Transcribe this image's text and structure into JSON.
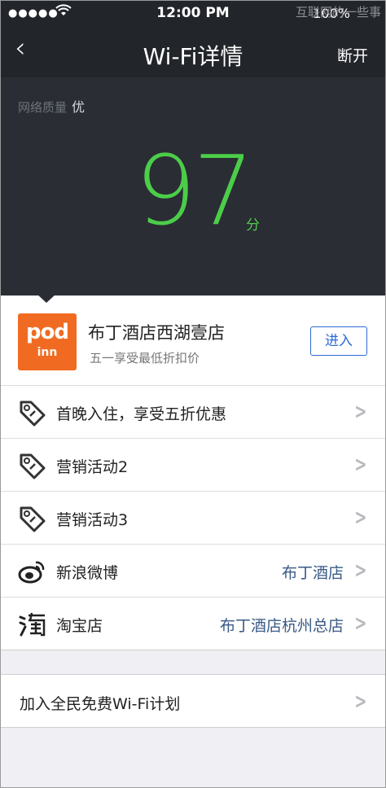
{
  "status_bar": {
    "signal": "●●●●●",
    "time": "12:00 PM",
    "battery": "100%",
    "watermark": "互联网的一些事"
  },
  "nav": {
    "back": "‹",
    "title": "Wi-Fi详情",
    "right": "断开"
  },
  "quality": {
    "label": "网络质量",
    "value": "优"
  },
  "score": {
    "value": "97",
    "unit": "分"
  },
  "merchant": {
    "logo_top": "pod",
    "logo_bottom": "inn",
    "name": "布丁酒店西湖壹店",
    "subtitle": "五一享受最低折扣价",
    "enter_label": "进入"
  },
  "list": [
    {
      "icon": "tag-icon",
      "label": "首晚入住，享受五折优惠",
      "value": ""
    },
    {
      "icon": "tag-icon",
      "label": "营销活动2",
      "value": ""
    },
    {
      "icon": "tag-icon",
      "label": "营销活动3",
      "value": ""
    },
    {
      "icon": "weibo-icon",
      "label": "新浪微博",
      "value": "布丁酒店"
    },
    {
      "icon": "taobao-icon",
      "label": "淘宝店",
      "value": "布丁酒店杭州总店"
    }
  ],
  "join": {
    "label": "加入全民免费Wi-Fi计划"
  },
  "colors": {
    "score": "#4ccd49",
    "accent": "#2e6ad5",
    "link": "#3a5a86",
    "logo": "#f06b21"
  }
}
